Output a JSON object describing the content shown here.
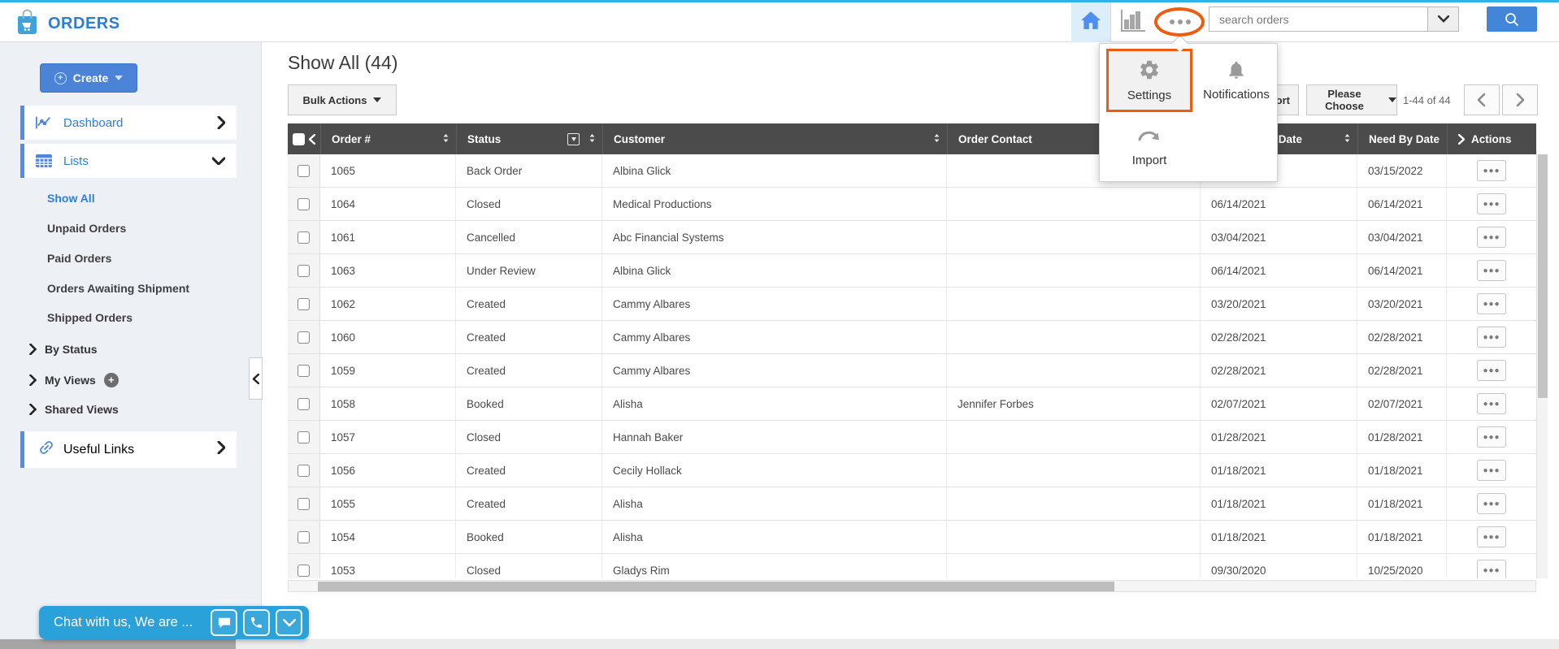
{
  "topbar": {
    "app_title": "ORDERS",
    "search_placeholder": "search orders"
  },
  "popup": {
    "settings_label": "Settings",
    "notifications_label": "Notifications",
    "import_label": "Import"
  },
  "toolbar": {
    "heading": "Show All (44)",
    "bulk_actions_label": "Bulk Actions",
    "export_label": "Export",
    "page_size_label": "Please Choose",
    "range_label": "1-44 of 44"
  },
  "sidebar": {
    "create_label": "Create",
    "nav": [
      {
        "label": "Dashboard"
      },
      {
        "label": "Lists"
      }
    ],
    "links": [
      "Show All",
      "Unpaid Orders",
      "Paid Orders",
      "Orders Awaiting Shipment",
      "Shipped Orders"
    ],
    "groups": [
      "By Status",
      "My Views",
      "Shared Views"
    ],
    "useful_links_label": "Useful Links"
  },
  "chat": {
    "label": "Chat with us, We are ..."
  },
  "table": {
    "columns": [
      "Order #",
      "Status",
      "Customer",
      "Order Contact",
      "Ship By Date",
      "Need By Date",
      "Actions"
    ],
    "actions_icon": "●●●",
    "rows": [
      {
        "order": "1065",
        "status": "Back Order",
        "customer": "Albina Glick",
        "contact": "",
        "ship_by": "",
        "need_by": "03/15/2022"
      },
      {
        "order": "1064",
        "status": "Closed",
        "customer": "Medical Productions",
        "contact": "",
        "ship_by": "06/14/2021",
        "need_by": "06/14/2021"
      },
      {
        "order": "1061",
        "status": "Cancelled",
        "customer": "Abc Financial Systems",
        "contact": "",
        "ship_by": "03/04/2021",
        "need_by": "03/04/2021"
      },
      {
        "order": "1063",
        "status": "Under Review",
        "customer": "Albina Glick",
        "contact": "",
        "ship_by": "06/14/2021",
        "need_by": "06/14/2021"
      },
      {
        "order": "1062",
        "status": "Created",
        "customer": "Cammy Albares",
        "contact": "",
        "ship_by": "03/20/2021",
        "need_by": "03/20/2021"
      },
      {
        "order": "1060",
        "status": "Created",
        "customer": "Cammy Albares",
        "contact": "",
        "ship_by": "02/28/2021",
        "need_by": "02/28/2021"
      },
      {
        "order": "1059",
        "status": "Created",
        "customer": "Cammy Albares",
        "contact": "",
        "ship_by": "02/28/2021",
        "need_by": "02/28/2021"
      },
      {
        "order": "1058",
        "status": "Booked",
        "customer": "Alisha",
        "contact": "Jennifer Forbes",
        "ship_by": "02/07/2021",
        "need_by": "02/07/2021"
      },
      {
        "order": "1057",
        "status": "Closed",
        "customer": "Hannah Baker",
        "contact": "",
        "ship_by": "01/28/2021",
        "need_by": "01/28/2021"
      },
      {
        "order": "1056",
        "status": "Created",
        "customer": "Cecily Hollack",
        "contact": "",
        "ship_by": "01/18/2021",
        "need_by": "01/18/2021"
      },
      {
        "order": "1055",
        "status": "Created",
        "customer": "Alisha",
        "contact": "",
        "ship_by": "01/18/2021",
        "need_by": "01/18/2021"
      },
      {
        "order": "1054",
        "status": "Booked",
        "customer": "Alisha",
        "contact": "",
        "ship_by": "01/18/2021",
        "need_by": "01/18/2021"
      },
      {
        "order": "1053",
        "status": "Closed",
        "customer": "Gladys Rim",
        "contact": "",
        "ship_by": "09/30/2020",
        "need_by": "10/25/2020"
      }
    ]
  },
  "colors": {
    "accent_blue": "#2e7dd1",
    "top_stripe": "#2db3ea",
    "annotation_orange": "#ee5c0f",
    "table_header_bg": "#4b4b4b",
    "chat_blue": "#2aa1d8"
  }
}
